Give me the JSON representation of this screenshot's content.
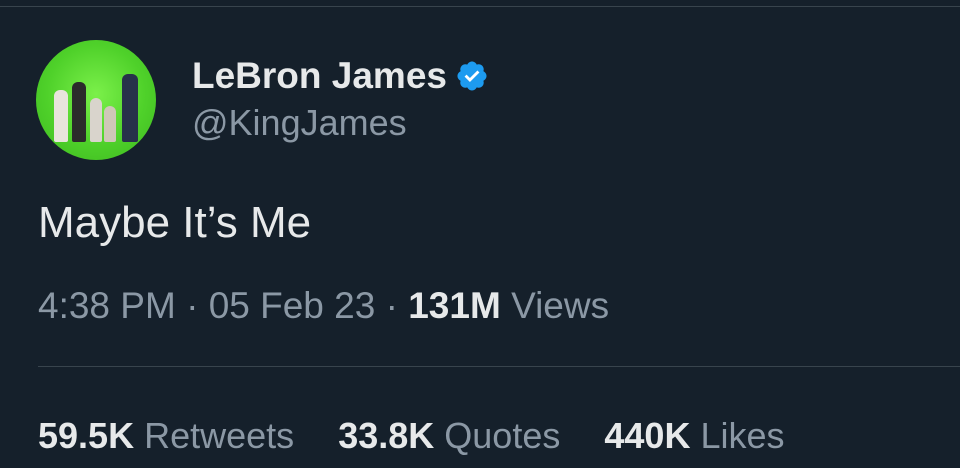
{
  "tweet": {
    "author": {
      "display_name": "LeBron James",
      "handle": "@KingJames",
      "verified_icon": "verified-badge-icon",
      "avatar_bg": "#4fd12a"
    },
    "text": "Maybe It’s Me",
    "time": "4:38 PM",
    "separator": "·",
    "date": "05 Feb 23",
    "views_count": "131M",
    "views_label": "Views"
  },
  "stats": {
    "retweets_count": "59.5K",
    "retweets_label": "Retweets",
    "quotes_count": "33.8K",
    "quotes_label": "Quotes",
    "likes_count": "440K",
    "likes_label": "Likes"
  },
  "colors": {
    "background": "#15202b",
    "primary_text": "#e7e9ea",
    "secondary_text": "#8b98a5",
    "verified_blue": "#1d9bf0",
    "divider": "#38444d"
  }
}
